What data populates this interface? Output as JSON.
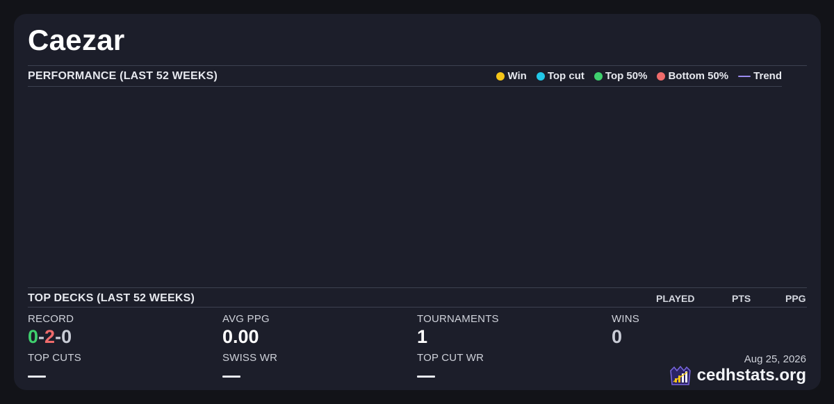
{
  "player": {
    "name": "Caezar"
  },
  "performance": {
    "label": "PERFORMANCE (LAST 52 WEEKS)",
    "legend": [
      {
        "label": "Win",
        "color": "#f5c518",
        "kind": "dot"
      },
      {
        "label": "Top cut",
        "color": "#22c7e8",
        "kind": "dot"
      },
      {
        "label": "Top 50%",
        "color": "#3fd06e",
        "kind": "dot"
      },
      {
        "label": "Bottom 50%",
        "color": "#ef6b6b",
        "kind": "dot"
      },
      {
        "label": "Trend",
        "color": "#9b8cf0",
        "kind": "line"
      }
    ]
  },
  "top_decks": {
    "label": "TOP DECKS (LAST 52 WEEKS)",
    "columns": {
      "played": "PLAYED",
      "pts": "PTS",
      "ppg": "PPG"
    }
  },
  "stats": {
    "record": {
      "label": "RECORD",
      "wins": "0",
      "losses": "2",
      "draws": "0",
      "sep": "-",
      "wins_color": "#3fd06e",
      "losses_color": "#ef6b6b",
      "draws_color": "#c9ccd6"
    },
    "avg_ppg": {
      "label": "AVG PPG",
      "value": "0.00"
    },
    "tournaments": {
      "label": "TOURNAMENTS",
      "value": "1"
    },
    "wins": {
      "label": "WINS",
      "value": "0"
    },
    "top_cuts": {
      "label": "TOP CUTS"
    },
    "swiss_wr": {
      "label": "SWISS WR"
    },
    "top_cut_wr": {
      "label": "TOP CUT WR"
    }
  },
  "footer": {
    "date": "Aug 25, 2026",
    "brand": "cedhstats.org",
    "brand_icon": "cedhstats-logo-icon"
  }
}
